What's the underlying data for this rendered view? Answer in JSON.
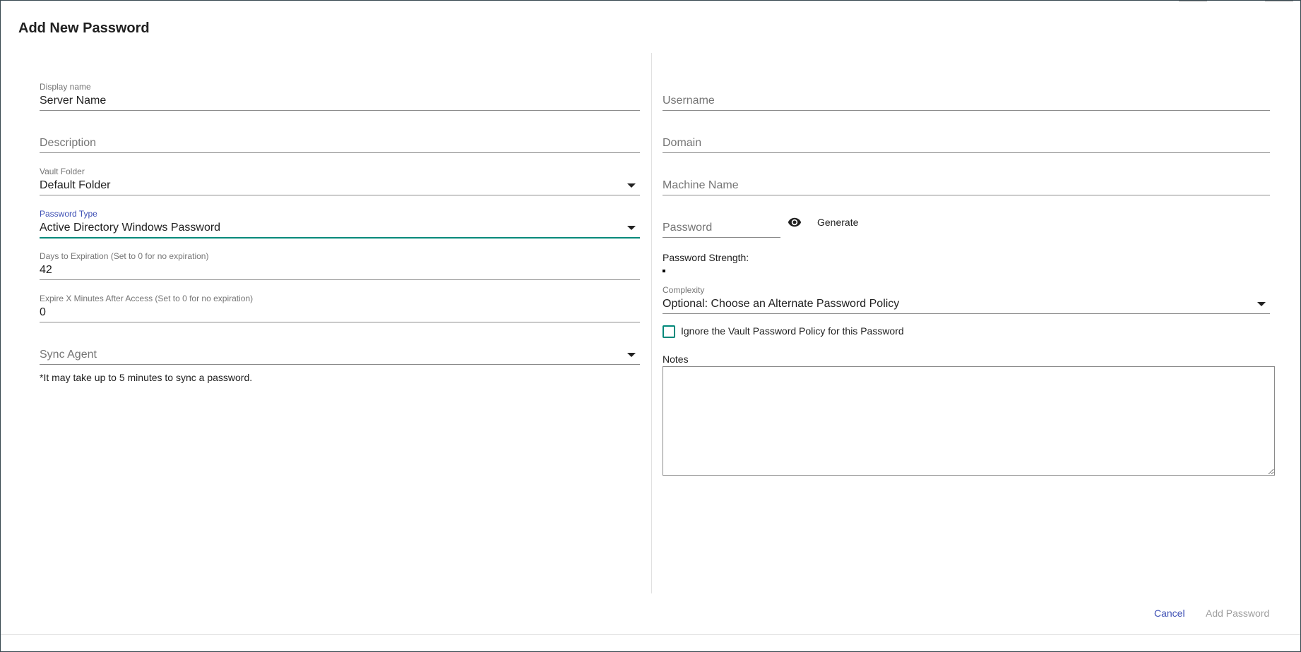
{
  "dialog": {
    "title": "Add New Password"
  },
  "left": {
    "display_name": {
      "label": "Display name",
      "value": "Server Name"
    },
    "description": {
      "placeholder": "Description"
    },
    "vault_folder": {
      "label": "Vault Folder",
      "value": "Default Folder"
    },
    "password_type": {
      "label": "Password Type",
      "value": "Active Directory Windows Password"
    },
    "days_to_expiration": {
      "label": "Days to Expiration (Set to 0 for no expiration)",
      "value": "42"
    },
    "expire_minutes": {
      "label": "Expire X Minutes After Access (Set to 0 for no expiration)",
      "value": "0"
    },
    "sync_agent": {
      "placeholder": "Sync Agent"
    },
    "sync_note": "*It may take up to 5 minutes to sync a password."
  },
  "right": {
    "username": {
      "placeholder": "Username"
    },
    "domain": {
      "placeholder": "Domain"
    },
    "machine_name": {
      "placeholder": "Machine Name"
    },
    "password": {
      "placeholder": "Password"
    },
    "generate_label": "Generate",
    "strength_label": "Password Strength:",
    "complexity": {
      "label": "Complexity",
      "value": "Optional: Choose an Alternate Password Policy"
    },
    "ignore_policy_label": "Ignore the Vault Password Policy for this Password",
    "ignore_policy_checked": false,
    "notes_label": "Notes",
    "notes_value": ""
  },
  "actions": {
    "cancel_label": "Cancel",
    "add_label": "Add Password"
  },
  "icons": {
    "visibility": "eye-icon",
    "dropdown": "chevron-down-icon"
  },
  "colors": {
    "accent_primary": "#3f51b5",
    "accent_focus": "#00897b",
    "disabled": "#9e9e9e"
  }
}
